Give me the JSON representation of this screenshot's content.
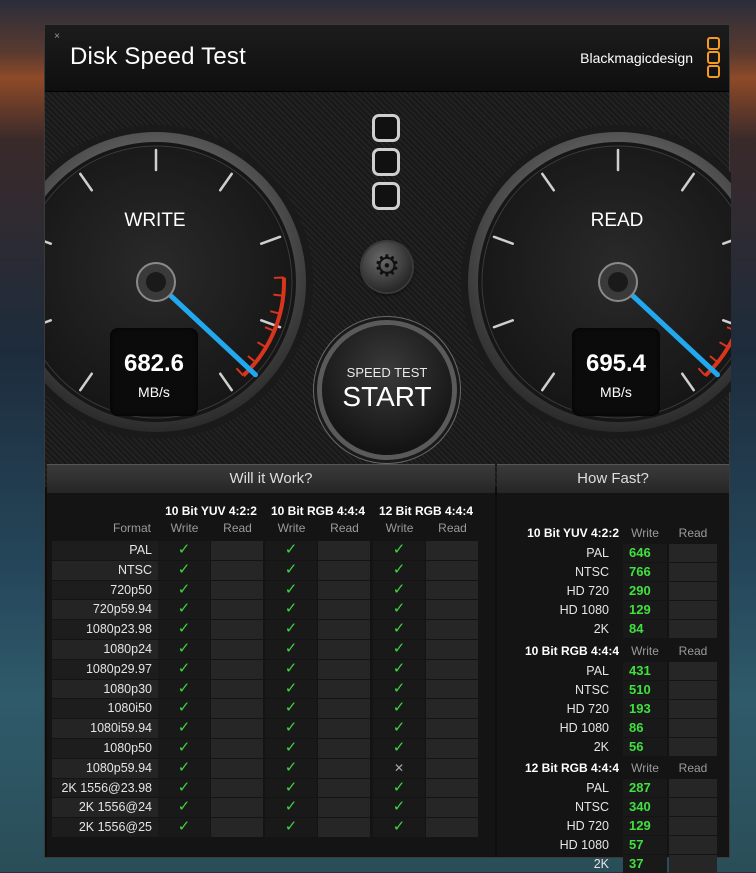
{
  "window": {
    "title": "Disk Speed Test",
    "brand": "Blackmagicdesign",
    "close_glyph": "×"
  },
  "gauges": {
    "write": {
      "label": "WRITE",
      "value": "682.6",
      "unit": "MB/s"
    },
    "read": {
      "label": "READ",
      "value": "695.4",
      "unit": "MB/s"
    }
  },
  "controls": {
    "start_sub": "SPEED TEST",
    "start_main": "START",
    "settings_icon": "gear-icon",
    "settings_glyph": "⚙"
  },
  "will_it_work": {
    "title": "Will it Work?",
    "format_header": "Format",
    "groups": [
      "10 Bit YUV 4:2:2",
      "10 Bit RGB 4:4:4",
      "12 Bit RGB 4:4:4"
    ],
    "write_label": "Write",
    "read_label": "Read",
    "formats": [
      "PAL",
      "NTSC",
      "720p50",
      "720p59.94",
      "1080p23.98",
      "1080p24",
      "1080p29.97",
      "1080p30",
      "1080i50",
      "1080i59.94",
      "1080p50",
      "1080p59.94",
      "2K 1556@23.98",
      "2K 1556@24",
      "2K 1556@25"
    ],
    "check_glyph": "✓",
    "cross_glyph": "✕",
    "results": [
      [
        "check",
        "",
        "check",
        "",
        "check",
        ""
      ],
      [
        "check",
        "",
        "check",
        "",
        "check",
        ""
      ],
      [
        "check",
        "",
        "check",
        "",
        "check",
        ""
      ],
      [
        "check",
        "",
        "check",
        "",
        "check",
        ""
      ],
      [
        "check",
        "",
        "check",
        "",
        "check",
        ""
      ],
      [
        "check",
        "",
        "check",
        "",
        "check",
        ""
      ],
      [
        "check",
        "",
        "check",
        "",
        "check",
        ""
      ],
      [
        "check",
        "",
        "check",
        "",
        "check",
        ""
      ],
      [
        "check",
        "",
        "check",
        "",
        "check",
        ""
      ],
      [
        "check",
        "",
        "check",
        "",
        "check",
        ""
      ],
      [
        "check",
        "",
        "check",
        "",
        "check",
        ""
      ],
      [
        "check",
        "",
        "check",
        "",
        "cross",
        ""
      ],
      [
        "check",
        "",
        "check",
        "",
        "check",
        ""
      ],
      [
        "check",
        "",
        "check",
        "",
        "check",
        ""
      ],
      [
        "check",
        "",
        "check",
        "",
        "check",
        ""
      ]
    ]
  },
  "how_fast": {
    "title": "How Fast?",
    "write_label": "Write",
    "read_label": "Read",
    "groups": [
      {
        "name": "10 Bit YUV 4:2:2",
        "rows": [
          {
            "format": "PAL",
            "write": "646",
            "read": ""
          },
          {
            "format": "NTSC",
            "write": "766",
            "read": ""
          },
          {
            "format": "HD 720",
            "write": "290",
            "read": ""
          },
          {
            "format": "HD 1080",
            "write": "129",
            "read": ""
          },
          {
            "format": "2K",
            "write": "84",
            "read": ""
          }
        ]
      },
      {
        "name": "10 Bit RGB 4:4:4",
        "rows": [
          {
            "format": "PAL",
            "write": "431",
            "read": ""
          },
          {
            "format": "NTSC",
            "write": "510",
            "read": ""
          },
          {
            "format": "HD 720",
            "write": "193",
            "read": ""
          },
          {
            "format": "HD 1080",
            "write": "86",
            "read": ""
          },
          {
            "format": "2K",
            "write": "56",
            "read": ""
          }
        ]
      },
      {
        "name": "12 Bit RGB 4:4:4",
        "rows": [
          {
            "format": "PAL",
            "write": "287",
            "read": ""
          },
          {
            "format": "NTSC",
            "write": "340",
            "read": ""
          },
          {
            "format": "HD 720",
            "write": "129",
            "read": ""
          },
          {
            "format": "HD 1080",
            "write": "57",
            "read": ""
          },
          {
            "format": "2K",
            "write": "37",
            "read": ""
          }
        ]
      }
    ]
  },
  "colors": {
    "needle": "#22a8ee",
    "check": "#3fd23f",
    "redzone": "#d8351c",
    "brand_accent": "#f39a22"
  }
}
